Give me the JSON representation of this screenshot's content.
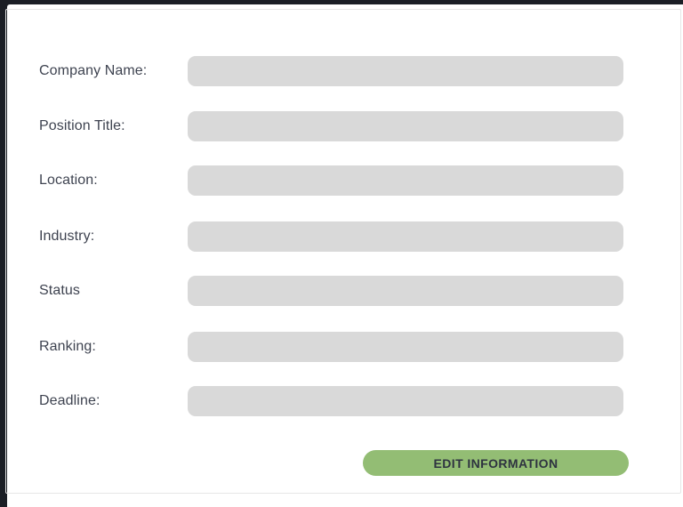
{
  "form": {
    "fields": [
      {
        "label": "Company Name:",
        "value": ""
      },
      {
        "label": "Position Title:",
        "value": ""
      },
      {
        "label": "Location:",
        "value": ""
      },
      {
        "label": "Industry:",
        "value": ""
      },
      {
        "label": "Status",
        "value": ""
      },
      {
        "label": "Ranking:",
        "value": ""
      },
      {
        "label": "Deadline:",
        "value": ""
      }
    ],
    "edit_button_label": "EDIT INFORMATION"
  },
  "colors": {
    "background": "#1b1e25",
    "panel": "#ffffff",
    "field": "#d9d9d9",
    "button": "#93bd74",
    "label_text": "#3e4350"
  }
}
